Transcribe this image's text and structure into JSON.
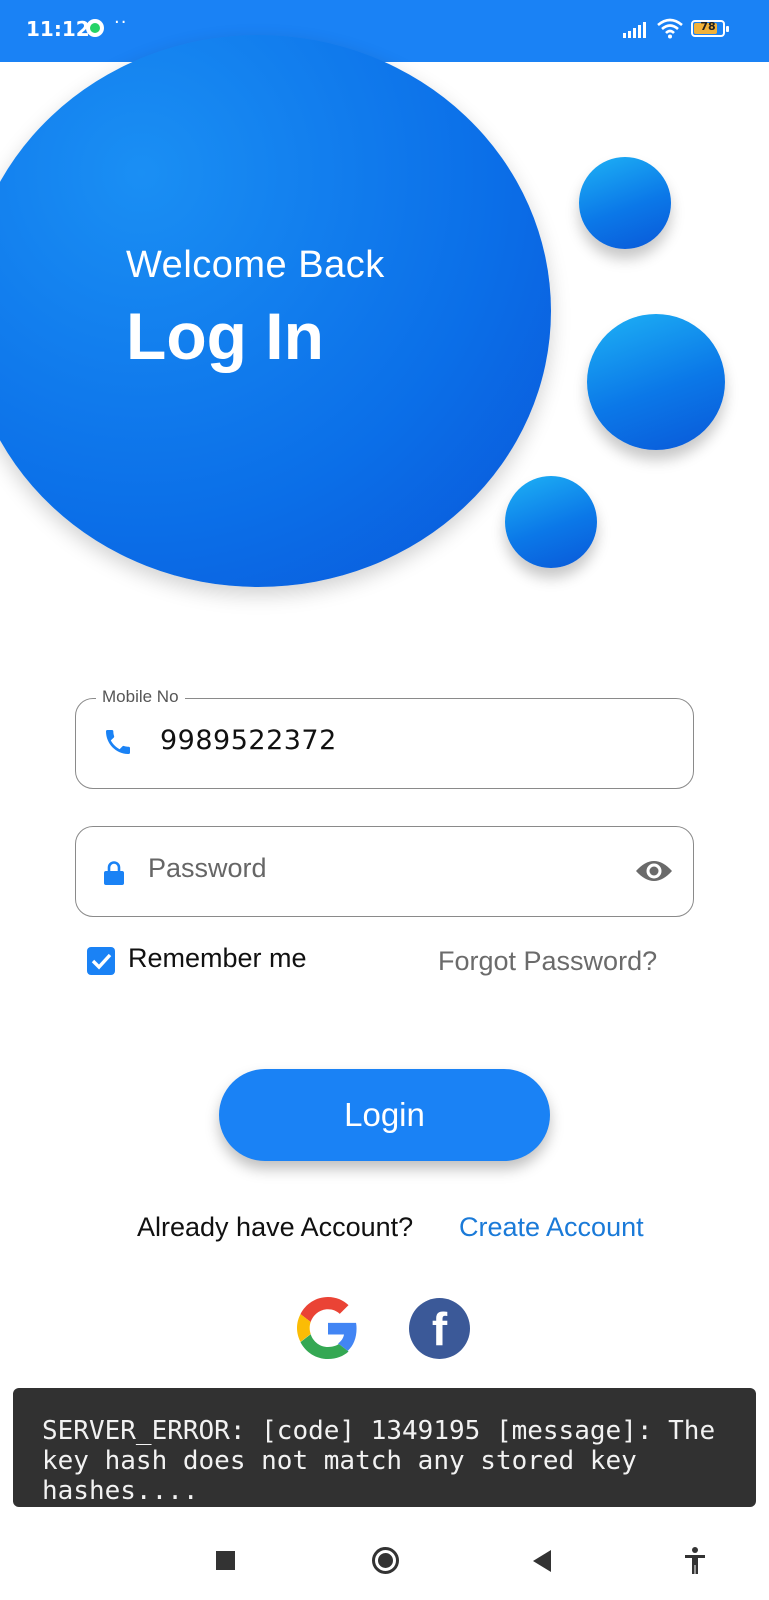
{
  "status_bar": {
    "time": "11:12",
    "dots": "··",
    "battery": "78"
  },
  "hero": {
    "welcome": "Welcome Back",
    "title": "Log In"
  },
  "form": {
    "mobile": {
      "label": "Mobile No",
      "value": "9989522372",
      "icon": "phone-icon"
    },
    "password": {
      "placeholder": "Password",
      "icon": "lock-icon",
      "toggle_icon": "eye-icon"
    },
    "remember_me": {
      "label": "Remember me",
      "checked": true
    },
    "forgot_password": "Forgot Password?",
    "login_button": "Login"
  },
  "account": {
    "prompt": "Already have Account?",
    "create_link": "Create Account"
  },
  "social": [
    "google-icon",
    "facebook-icon"
  ],
  "toast": {
    "message": "SERVER_ERROR: [code] 1349195 [message]: The key hash does not match any stored key hashes...."
  },
  "colors": {
    "primary": "#1a82f5",
    "link": "#1a7ad8",
    "toast_bg": "#313131"
  }
}
